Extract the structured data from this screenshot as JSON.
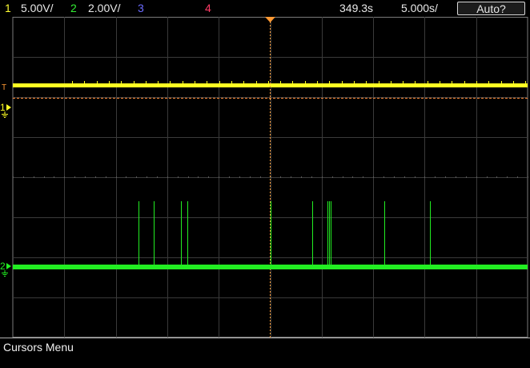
{
  "top_bar": {
    "channels": [
      {
        "number": "1",
        "scale": "5.00V/",
        "color": "#ffff33"
      },
      {
        "number": "2",
        "scale": "2.00V/",
        "color": "#33ee33"
      },
      {
        "number": "3",
        "scale": "",
        "color": "#6b6bff"
      },
      {
        "number": "4",
        "scale": "",
        "color": "#ff3a66"
      }
    ],
    "horizontal_delay": "349.3s",
    "horizontal_scale": "5.000s/",
    "trigger_mode_button": "Auto?"
  },
  "screen": {
    "trigger_level_marker": "T",
    "channel1_marker": "1",
    "channel2_marker": "2",
    "grid_divisions": {
      "horizontal": 10,
      "vertical": 8
    },
    "grid_color": "#3a3a3a",
    "trigger_color": "#ff9933",
    "channel2_pulses_fraction_of_width": [
      0.244,
      0.273,
      0.326,
      0.339,
      0.501,
      0.581,
      0.611,
      0.614,
      0.618,
      0.722,
      0.811
    ]
  },
  "bottom_bar": {
    "menu_title": "Cursors Menu"
  }
}
